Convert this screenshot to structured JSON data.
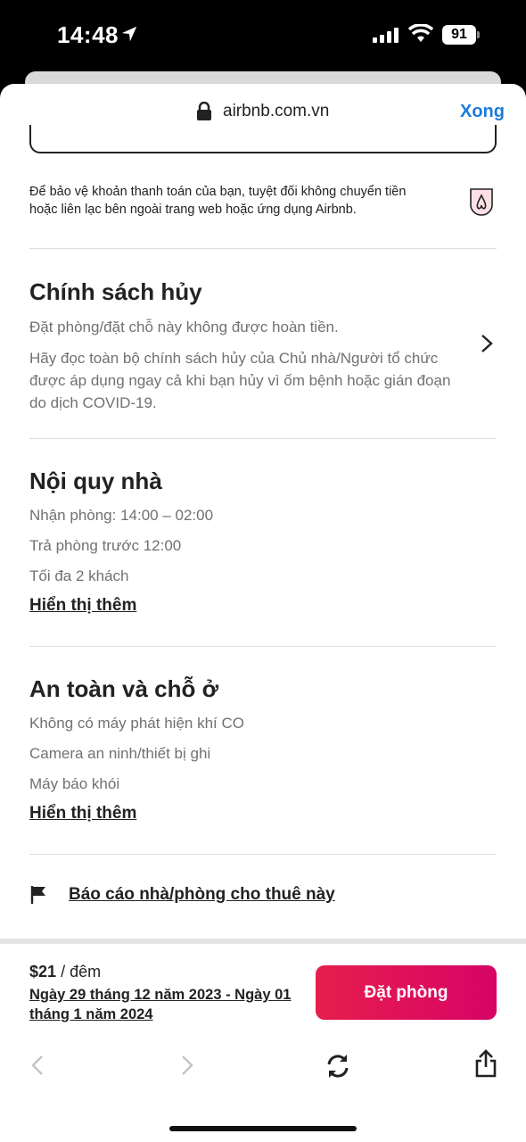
{
  "status": {
    "time": "14:48",
    "battery": "91"
  },
  "browser": {
    "url": "airbnb.com.vn",
    "done_label": "Xong"
  },
  "notice": "Để bảo vệ khoản thanh toán của bạn, tuyệt đối không chuyển tiền hoặc liên lạc bên ngoài trang web hoặc ứng dụng Airbnb.",
  "cancellation": {
    "title": "Chính sách hủy",
    "line1": "Đặt phòng/đặt chỗ này không được hoàn tiền.",
    "line2": "Hãy đọc toàn bộ chính sách hủy của Chủ nhà/Người tổ chức được áp dụng ngay cả khi bạn hủy vì ốm bệnh hoặc gián đoạn do dịch COVID-19."
  },
  "house_rules": {
    "title": "Nội quy nhà",
    "items": [
      "Nhận phòng: 14:00 – 02:00",
      "Trả phòng trước 12:00",
      "Tối đa 2 khách"
    ],
    "show_more": "Hiển thị thêm"
  },
  "safety": {
    "title": "An toàn và chỗ ở",
    "items": [
      "Không có máy phát hiện khí CO",
      "Camera an ninh/thiết bị ghi",
      "Máy báo khói"
    ],
    "show_more": "Hiển thị thêm"
  },
  "report": {
    "label": "Báo cáo nhà/phòng cho thuê này"
  },
  "footer": {
    "price": "$21",
    "per": "/ đêm",
    "dates": "Ngày 29 tháng 12 năm 2023 - Ngày 01 tháng 1 năm 2024",
    "book_label": "Đặt phòng"
  },
  "colors": {
    "accent": "#e61e4d",
    "link": "#1a7cd9"
  }
}
